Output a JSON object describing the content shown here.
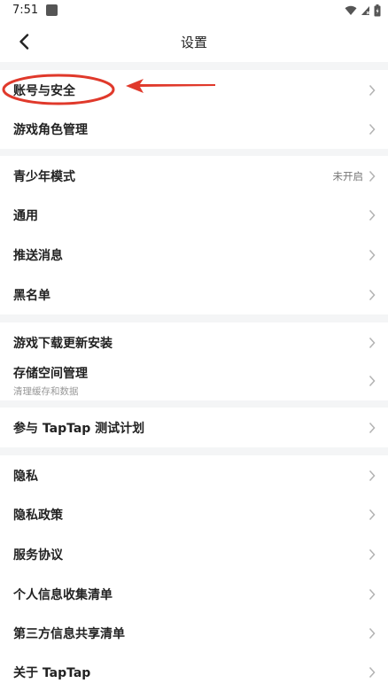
{
  "status_bar": {
    "time": "7:51"
  },
  "header": {
    "title": "设置"
  },
  "sections": {
    "account": [
      {
        "label": "账号与安全"
      },
      {
        "label": "游戏角色管理"
      }
    ],
    "general": [
      {
        "label": "青少年模式",
        "value": "未开启"
      },
      {
        "label": "通用"
      },
      {
        "label": "推送消息"
      },
      {
        "label": "黑名单"
      }
    ],
    "storage": [
      {
        "label": "游戏下载更新安装"
      },
      {
        "label": "存储空间管理",
        "sublabel": "清理缓存和数据"
      }
    ],
    "beta": [
      {
        "label": "参与 TapTap 测试计划"
      }
    ],
    "legal": [
      {
        "label": "隐私"
      },
      {
        "label": "隐私政策"
      },
      {
        "label": "服务协议"
      },
      {
        "label": "个人信息收集清单"
      },
      {
        "label": "第三方信息共享清单"
      },
      {
        "label": "关于 TapTap"
      }
    ]
  },
  "annotation": {
    "color": "#e0392b"
  },
  "icons": {
    "back": "chevron-left-icon",
    "row_arrow": "chevron-right-icon",
    "wifi": "wifi-icon",
    "signal": "cell-signal-icon",
    "battery": "battery-icon"
  }
}
